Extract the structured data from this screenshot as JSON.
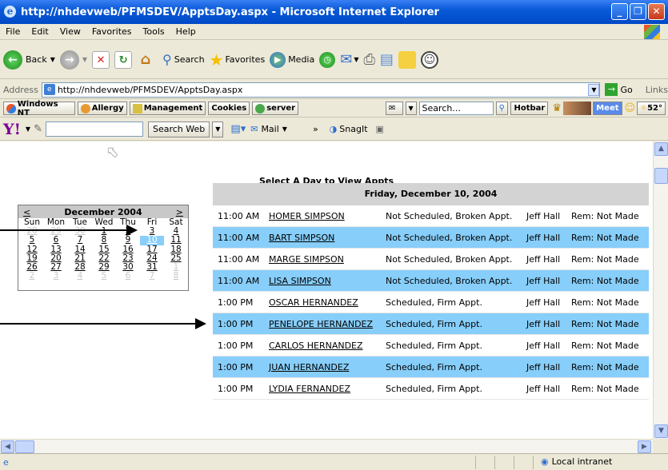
{
  "window": {
    "title": "http://nhdevweb/PFMSDEV/ApptsDay.aspx - Microsoft Internet Explorer"
  },
  "menu": {
    "items": [
      "File",
      "Edit",
      "View",
      "Favorites",
      "Tools",
      "Help"
    ]
  },
  "toolbar": {
    "back": "Back",
    "search": "Search",
    "favorites": "Favorites",
    "media": "Media"
  },
  "address": {
    "label": "Address",
    "url": "http://nhdevweb/PFMSDEV/ApptsDay.aspx",
    "go": "Go",
    "links": "Links"
  },
  "linksbar": {
    "items": [
      "Windows NT",
      "Allergy",
      "Management",
      "Cookies",
      "server"
    ],
    "search_value": "Search...",
    "hotbar": "Hotbar",
    "meet": "Meet",
    "temp": "52°"
  },
  "yahoo": {
    "search_web": "Search Web",
    "mail": "Mail",
    "chevron": "»",
    "snagit": "SnagIt"
  },
  "page": {
    "heading": "Select A Day to View Appts"
  },
  "calendar": {
    "prev": "<",
    "next": ">",
    "month": "December 2004",
    "dow": [
      "Sun",
      "Mon",
      "Tue",
      "Wed",
      "Thu",
      "Fri",
      "Sat"
    ],
    "weeks": [
      [
        "28",
        "29",
        "30",
        "1",
        "2",
        "3",
        "4"
      ],
      [
        "5",
        "6",
        "7",
        "8",
        "9",
        "10",
        "11"
      ],
      [
        "12",
        "13",
        "14",
        "15",
        "16",
        "17",
        "18"
      ],
      [
        "19",
        "20",
        "21",
        "22",
        "23",
        "24",
        "25"
      ],
      [
        "26",
        "27",
        "28",
        "29",
        "30",
        "31",
        "1"
      ],
      [
        "2",
        "3",
        "4",
        "5",
        "6",
        "7",
        "8"
      ]
    ],
    "selected": "10"
  },
  "appointments": {
    "date_header": "Friday, December 10, 2004",
    "rows": [
      {
        "time": "11:00 AM",
        "name": "HOMER SIMPSON",
        "status": "Not Scheduled, Broken Appt.",
        "provider": "Jeff Hall",
        "rem": "Rem: Not Made"
      },
      {
        "time": "11:00 AM",
        "name": "BART SIMPSON",
        "status": "Not Scheduled, Broken Appt.",
        "provider": "Jeff Hall",
        "rem": "Rem: Not Made"
      },
      {
        "time": "11:00 AM",
        "name": "MARGE SIMPSON",
        "status": "Not Scheduled, Broken Appt.",
        "provider": "Jeff Hall",
        "rem": "Rem: Not Made"
      },
      {
        "time": "11:00 AM",
        "name": "LISA SIMPSON",
        "status": "Not Scheduled, Broken Appt.",
        "provider": "Jeff Hall",
        "rem": "Rem: Not Made"
      },
      {
        "time": "1:00 PM",
        "name": "OSCAR HERNANDEZ",
        "status": "Scheduled, Firm Appt.",
        "provider": "Jeff Hall",
        "rem": "Rem: Not Made"
      },
      {
        "time": "1:00 PM",
        "name": "PENELOPE HERNANDEZ",
        "status": "Scheduled, Firm Appt.",
        "provider": "Jeff Hall",
        "rem": "Rem: Not Made"
      },
      {
        "time": "1:00 PM",
        "name": "CARLOS HERNANDEZ",
        "status": "Scheduled, Firm Appt.",
        "provider": "Jeff Hall",
        "rem": "Rem: Not Made"
      },
      {
        "time": "1:00 PM",
        "name": "JUAN HERNANDEZ",
        "status": "Scheduled, Firm Appt.",
        "provider": "Jeff Hall",
        "rem": "Rem: Not Made"
      },
      {
        "time": "1:00 PM",
        "name": "LYDIA FERNANDEZ",
        "status": "Scheduled, Firm Appt.",
        "provider": "Jeff Hall",
        "rem": "Rem: Not Made"
      }
    ]
  },
  "status": {
    "zone": "Local intranet"
  },
  "colors": {
    "row_highlight": "#87cefa",
    "header_gray": "#d3d3d3",
    "titlebar": "#0a5ad9"
  }
}
